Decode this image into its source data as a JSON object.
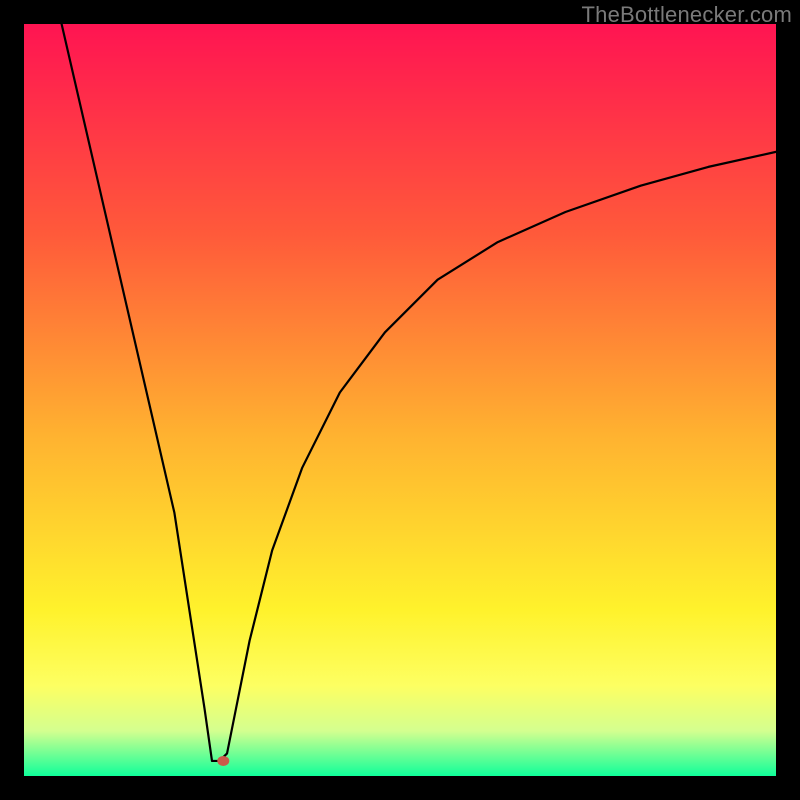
{
  "watermark": "TheBottlenecker.com",
  "chart_data": {
    "type": "line",
    "title": "",
    "xlabel": "",
    "ylabel": "",
    "xlim": [
      0,
      100
    ],
    "ylim": [
      0,
      100
    ],
    "background_gradient": {
      "stops": [
        {
          "offset": 0,
          "color": "#ff1452"
        },
        {
          "offset": 0.28,
          "color": "#ff5a3a"
        },
        {
          "offset": 0.55,
          "color": "#ffb330"
        },
        {
          "offset": 0.78,
          "color": "#fff22c"
        },
        {
          "offset": 0.88,
          "color": "#fdff62"
        },
        {
          "offset": 0.94,
          "color": "#d4ff8f"
        },
        {
          "offset": 1.0,
          "color": "#10ff9a"
        }
      ]
    },
    "curve": {
      "description": "V-shaped bottleneck curve; steep linear descent, a short flat minimum around x≈25, then a decelerating rise approaching ~83 at x=100",
      "x": [
        5,
        8,
        11,
        14,
        17,
        20,
        22,
        24,
        25,
        26,
        27,
        28,
        30,
        33,
        37,
        42,
        48,
        55,
        63,
        72,
        82,
        91,
        100
      ],
      "y": [
        100,
        87,
        74,
        61,
        48,
        35,
        22,
        9,
        2,
        2,
        3,
        8,
        18,
        30,
        41,
        51,
        59,
        66,
        71,
        75,
        78.5,
        81,
        83
      ]
    },
    "marker": {
      "x": 26.5,
      "y": 2,
      "color": "#cb5a4a",
      "rx": 6,
      "ry": 5
    }
  }
}
